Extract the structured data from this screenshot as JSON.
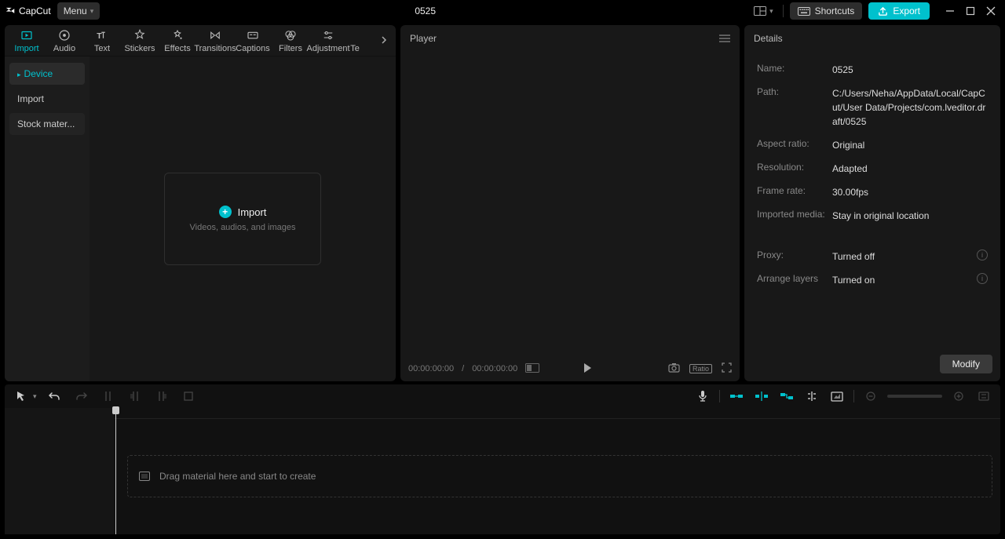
{
  "app": {
    "name": "CapCut",
    "project_title": "0525"
  },
  "titlebar": {
    "menu": "Menu",
    "shortcuts": "Shortcuts",
    "export": "Export"
  },
  "media": {
    "tabs": {
      "import": "Import",
      "audio": "Audio",
      "text": "Text",
      "stickers": "Stickers",
      "effects": "Effects",
      "transitions": "Transitions",
      "captions": "Captions",
      "filters": "Filters",
      "adjustment": "Adjustment",
      "te": "Te"
    },
    "side": {
      "device": "Device",
      "import": "Import",
      "stock": "Stock mater..."
    },
    "import_box": {
      "title": "Import",
      "subtitle": "Videos, audios, and images"
    }
  },
  "player": {
    "title": "Player",
    "time_current": "00:00:00:00",
    "time_sep": "/",
    "time_total": "00:00:00:00"
  },
  "details": {
    "title": "Details",
    "rows": {
      "name_label": "Name:",
      "name_value": "0525",
      "path_label": "Path:",
      "path_value": "C:/Users/Neha/AppData/Local/CapCut/User Data/Projects/com.lveditor.draft/0525",
      "aspect_label": "Aspect ratio:",
      "aspect_value": "Original",
      "resolution_label": "Resolution:",
      "resolution_value": "Adapted",
      "framerate_label": "Frame rate:",
      "framerate_value": "30.00fps",
      "imported_label": "Imported media:",
      "imported_value": "Stay in original location",
      "proxy_label": "Proxy:",
      "proxy_value": "Turned off",
      "layers_label": "Arrange layers",
      "layers_value": "Turned on"
    },
    "modify": "Modify"
  },
  "timeline": {
    "drag_hint": "Drag material here and start to create"
  }
}
